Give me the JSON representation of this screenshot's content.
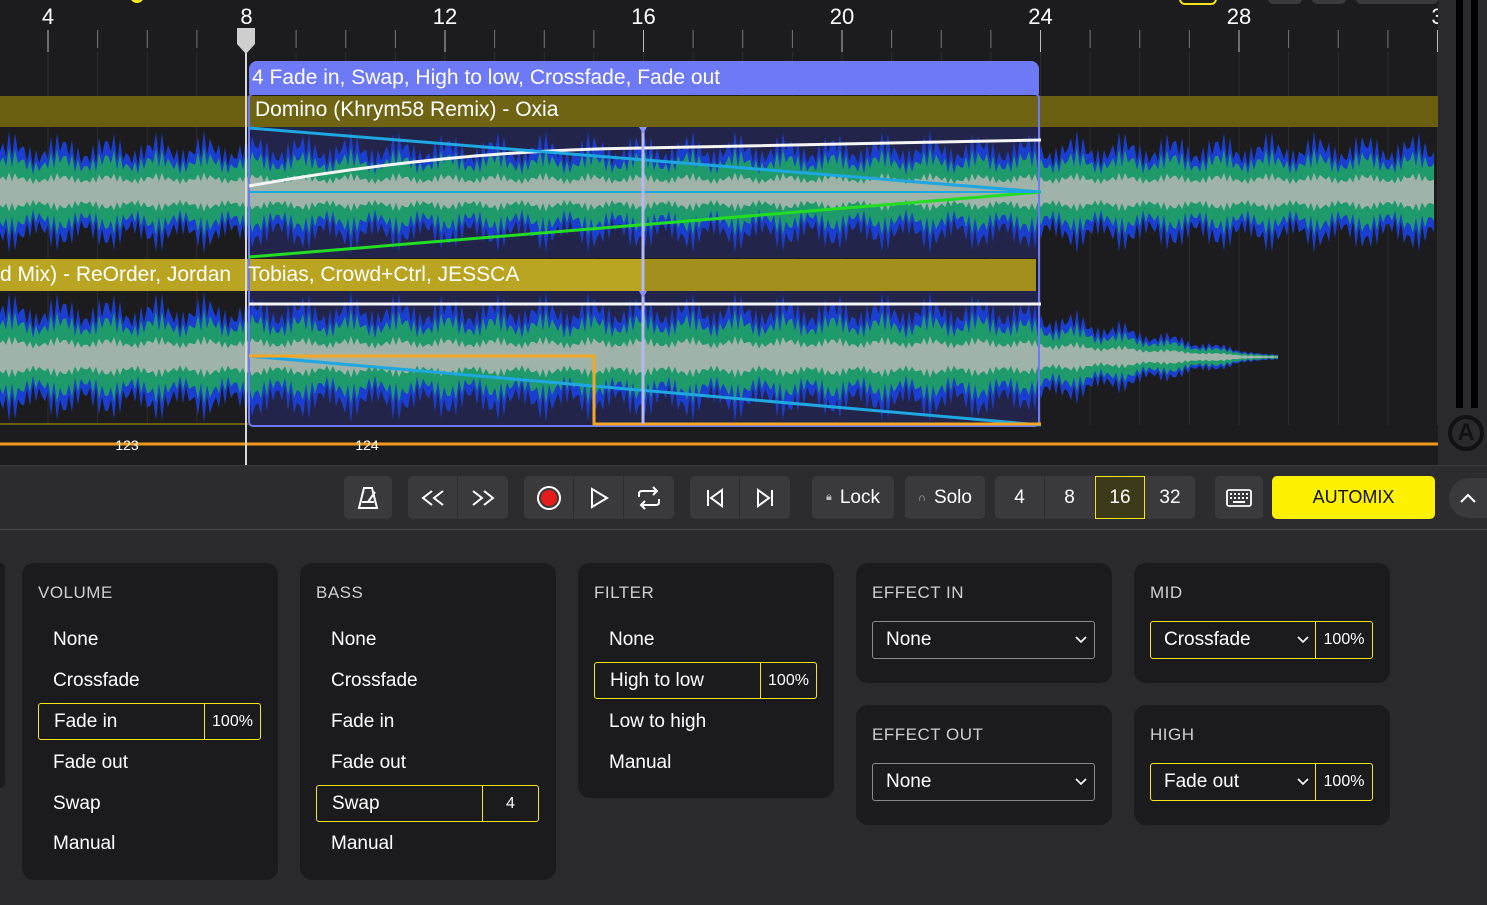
{
  "timeline": {
    "ruler": [
      "4",
      "8",
      "12",
      "16",
      "20",
      "24",
      "28",
      "3"
    ],
    "transition_label": "4 Fade in, Swap, High to low, Crossfade, Fade out",
    "track_a_title": "Domino (Khrym58 Remix) - Oxia",
    "track_b_title_left": "d Mix) - ReOrder, Jordan",
    "track_b_title_right": "Tobias, Crowd+Ctrl, JESSCA",
    "beat_numbers": [
      "123",
      "124"
    ]
  },
  "toolbar": {
    "lock": "Lock",
    "solo": "Solo",
    "grid": [
      "4",
      "8",
      "16",
      "32"
    ],
    "grid_active": "16",
    "automix": "AUTOMIX"
  },
  "panels": {
    "volume": {
      "title": "VOLUME",
      "options": [
        "None",
        "Crossfade",
        "Fade in",
        "Fade out",
        "Swap",
        "Manual"
      ],
      "selected_value": "100%"
    },
    "bass": {
      "title": "BASS",
      "options": [
        "None",
        "Crossfade",
        "Fade in",
        "Fade out",
        "Swap",
        "Manual"
      ],
      "selected_value": "4"
    },
    "filter": {
      "title": "FILTER",
      "options": [
        "None",
        "High to low",
        "Low to high",
        "Manual"
      ],
      "selected_value": "100%"
    },
    "effect_in": {
      "title": "EFFECT IN",
      "value": "None"
    },
    "effect_out": {
      "title": "EFFECT OUT",
      "value": "None"
    },
    "mid": {
      "title": "MID",
      "value": "Crossfade",
      "amount": "100%"
    },
    "high": {
      "title": "HIGH",
      "value": "Fade out",
      "amount": "100%"
    }
  },
  "colors": {
    "accent_yellow": "#fff200",
    "selection_border": "#f5e51b",
    "transition_blue": "#6d79f5",
    "track_bar": "#6b5e10"
  }
}
